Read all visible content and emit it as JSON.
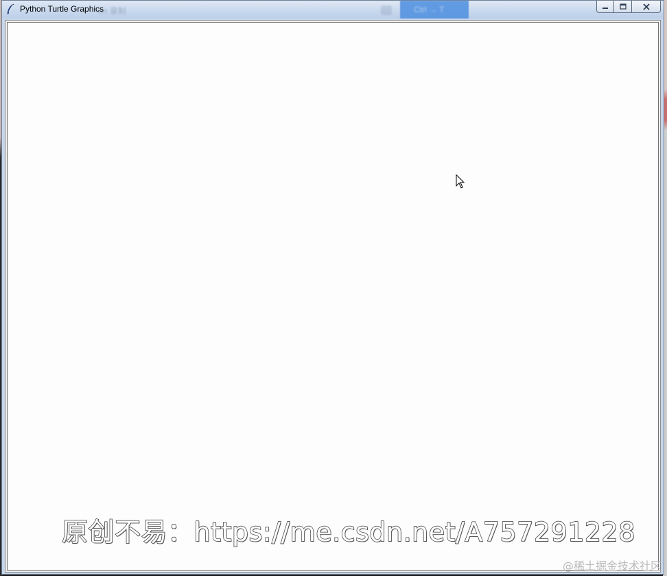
{
  "window": {
    "title": "Python Turtle Graphics",
    "app_icon": "feather-icon",
    "controls": {
      "minimize_icon": "minimize-icon",
      "maximize_icon": "maximize-icon",
      "close_icon": "close-icon"
    }
  },
  "background_ghost": {
    "faint_text": "on 录制",
    "button_label": "Ctrl → T",
    "button_color": "#4d8fe0"
  },
  "canvas": {
    "background": "#fdfdfd",
    "cursor_icon": "arrow-cursor-icon"
  },
  "watermarks": {
    "main": "原创不易：https://me.csdn.net/A757291228",
    "site": "@稀土掘金技术社区"
  }
}
